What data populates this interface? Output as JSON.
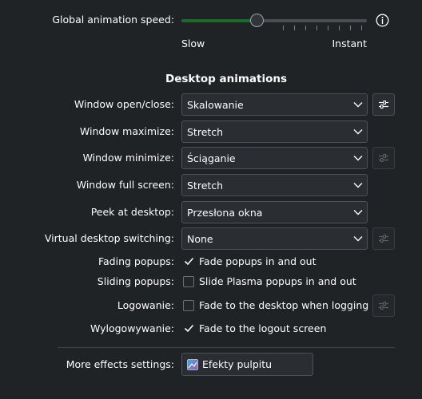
{
  "animation_speed": {
    "label": "Global animation speed:",
    "slow_label": "Slow",
    "instant_label": "Instant",
    "value_fraction": 0.4
  },
  "section_title": "Desktop animations",
  "rows": {
    "window_open_close": {
      "label": "Window open/close:",
      "value": "Skalowanie"
    },
    "window_maximize": {
      "label": "Window maximize:",
      "value": "Stretch"
    },
    "window_minimize": {
      "label": "Window minimize:",
      "value": "Ściąganie"
    },
    "window_full_screen": {
      "label": "Window full screen:",
      "value": "Stretch"
    },
    "peek_at_desktop": {
      "label": "Peek at desktop:",
      "value": "Przesłona okna"
    },
    "virtual_desktop_switching": {
      "label": "Virtual desktop switching:",
      "value": "None"
    }
  },
  "checks": {
    "fading_popups": {
      "label": "Fading popups:",
      "text": "Fade popups in and out",
      "checked": true
    },
    "sliding_popups": {
      "label": "Sliding popups:",
      "text": "Slide Plasma popups in and out",
      "checked": false
    },
    "logowanie": {
      "label": "Logowanie:",
      "text": "Fade to the desktop when logging in",
      "checked": false
    },
    "wylogowywanie": {
      "label": "Wylogowywanie:",
      "text": "Fade to the logout screen",
      "checked": true
    }
  },
  "more_effects": {
    "label": "More effects settings:",
    "button": "Efekty pulpitu"
  },
  "colors": {
    "accent": "#3daee9",
    "slider_fill": "#1d6a2d",
    "background": "#202326"
  }
}
